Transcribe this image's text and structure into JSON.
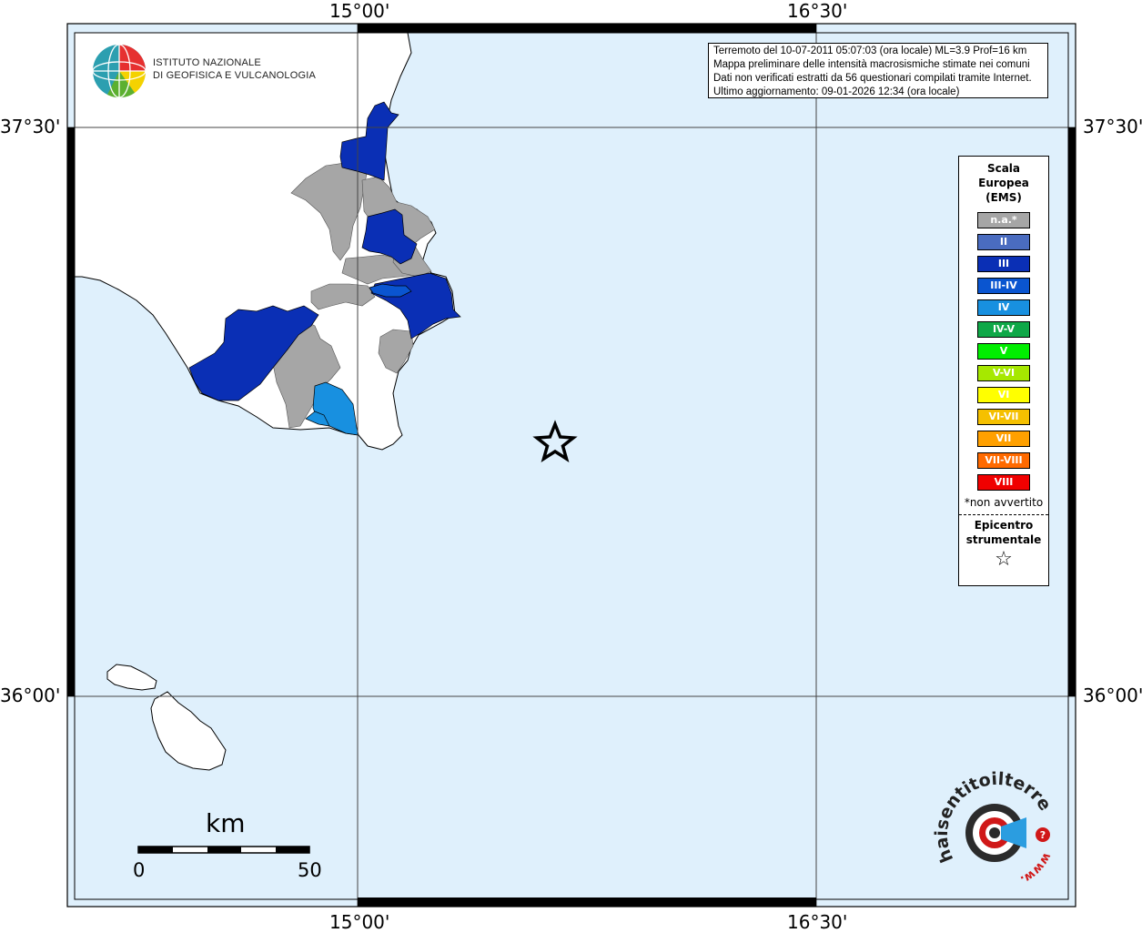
{
  "map": {
    "coord_labels": {
      "top_left_lon": "15°00'",
      "top_right_lon": "16°30'",
      "bottom_left_lon": "15°00'",
      "bottom_right_lon": "16°30'",
      "left_top_lat": "37°30'",
      "left_bottom_lat": "36°00'",
      "right_top_lat": "37°30'",
      "right_bottom_lat": "36°00'"
    },
    "colors": {
      "sea": "#dff0fc",
      "land": "#ffffff",
      "not_felt": "#a6a6a6",
      "int_III": "#0a2fb5",
      "int_IV": "#1890e0"
    }
  },
  "logo": {
    "line1": "ISTITUTO NAZIONALE",
    "line2": "DI GEOFISICA E VULCANOLOGIA",
    "icon": "ingv-globe-icon"
  },
  "info": {
    "line1": "Terremoto del 10-07-2011 05:07:03 (ora locale) ML=3.9 Prof=16 km",
    "line2": "Mappa preliminare delle intensità macrosismiche stimate nei comuni",
    "line3": "Dati non verificati estratti da 56 questionari compilati tramite Internet.",
    "line4": "Ultimo aggiornamento: 09-01-2026 12:34 (ora locale)"
  },
  "legend": {
    "title_line1": "Scala",
    "title_line2": "Europea",
    "title_line3": "(EMS)",
    "items": [
      {
        "label": "n.a.*",
        "color": "#a6a6a6"
      },
      {
        "label": "II",
        "color": "#4a6cc0"
      },
      {
        "label": "III",
        "color": "#0a2fb5"
      },
      {
        "label": "III-IV",
        "color": "#0a55d0"
      },
      {
        "label": "IV",
        "color": "#1890e0"
      },
      {
        "label": "IV-V",
        "color": "#0fa848"
      },
      {
        "label": "V",
        "color": "#00ee00"
      },
      {
        "label": "V-VI",
        "color": "#a6e800"
      },
      {
        "label": "VI",
        "color": "#ffff00"
      },
      {
        "label": "VI-VII",
        "color": "#f5c000"
      },
      {
        "label": "VII",
        "color": "#ffa000"
      },
      {
        "label": "VII-VIII",
        "color": "#ff6a00"
      },
      {
        "label": "VIII",
        "color": "#f00000"
      }
    ],
    "note": "*non avvertito",
    "epicenter_line1": "Epicentro",
    "epicenter_line2": "strumentale",
    "star_icon": "star-icon"
  },
  "scale_bar": {
    "unit": "km",
    "start": "0",
    "end": "50"
  },
  "badge": {
    "arc_text": "haisentitoilterremoto.it",
    "www_text": "www.",
    "icon": "target-megaphone-icon"
  }
}
